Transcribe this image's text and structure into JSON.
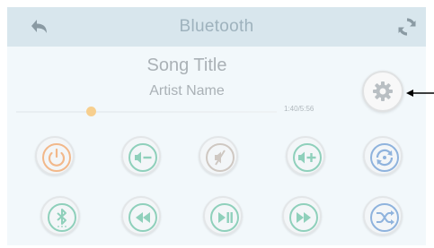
{
  "header": {
    "title": "Bluetooth",
    "back_icon": "back-arrow-icon",
    "refresh_icon": "refresh-icon"
  },
  "track": {
    "title": "Song Title",
    "artist": "Artist Name",
    "time": "1:40/5:56",
    "progress": 0.28
  },
  "settings_icon": "gear-icon",
  "controls_row1": [
    {
      "icon": "power-icon",
      "color": "#f2b88a"
    },
    {
      "icon": "volume-down-icon",
      "color": "#8fd0bb"
    },
    {
      "icon": "mute-icon",
      "color": "#cfc8c2"
    },
    {
      "icon": "volume-up-icon",
      "color": "#8fd0bb"
    },
    {
      "icon": "repeat-icon",
      "color": "#8fb3dd"
    }
  ],
  "controls_row2": [
    {
      "icon": "bluetooth-icon",
      "color": "#8fd0bb"
    },
    {
      "icon": "rewind-icon",
      "color": "#8fd0bb"
    },
    {
      "icon": "play-pause-icon",
      "color": "#8fd0bb"
    },
    {
      "icon": "fast-forward-icon",
      "color": "#8fd0bb"
    },
    {
      "icon": "shuffle-icon",
      "color": "#8fb3dd"
    }
  ],
  "colors": {
    "header_bg": "#d8e6ed",
    "screen_bg": "#f2f8fb",
    "accent_orange": "#f2b88a",
    "accent_teal": "#8fd0bb",
    "accent_blue": "#8fb3dd"
  }
}
